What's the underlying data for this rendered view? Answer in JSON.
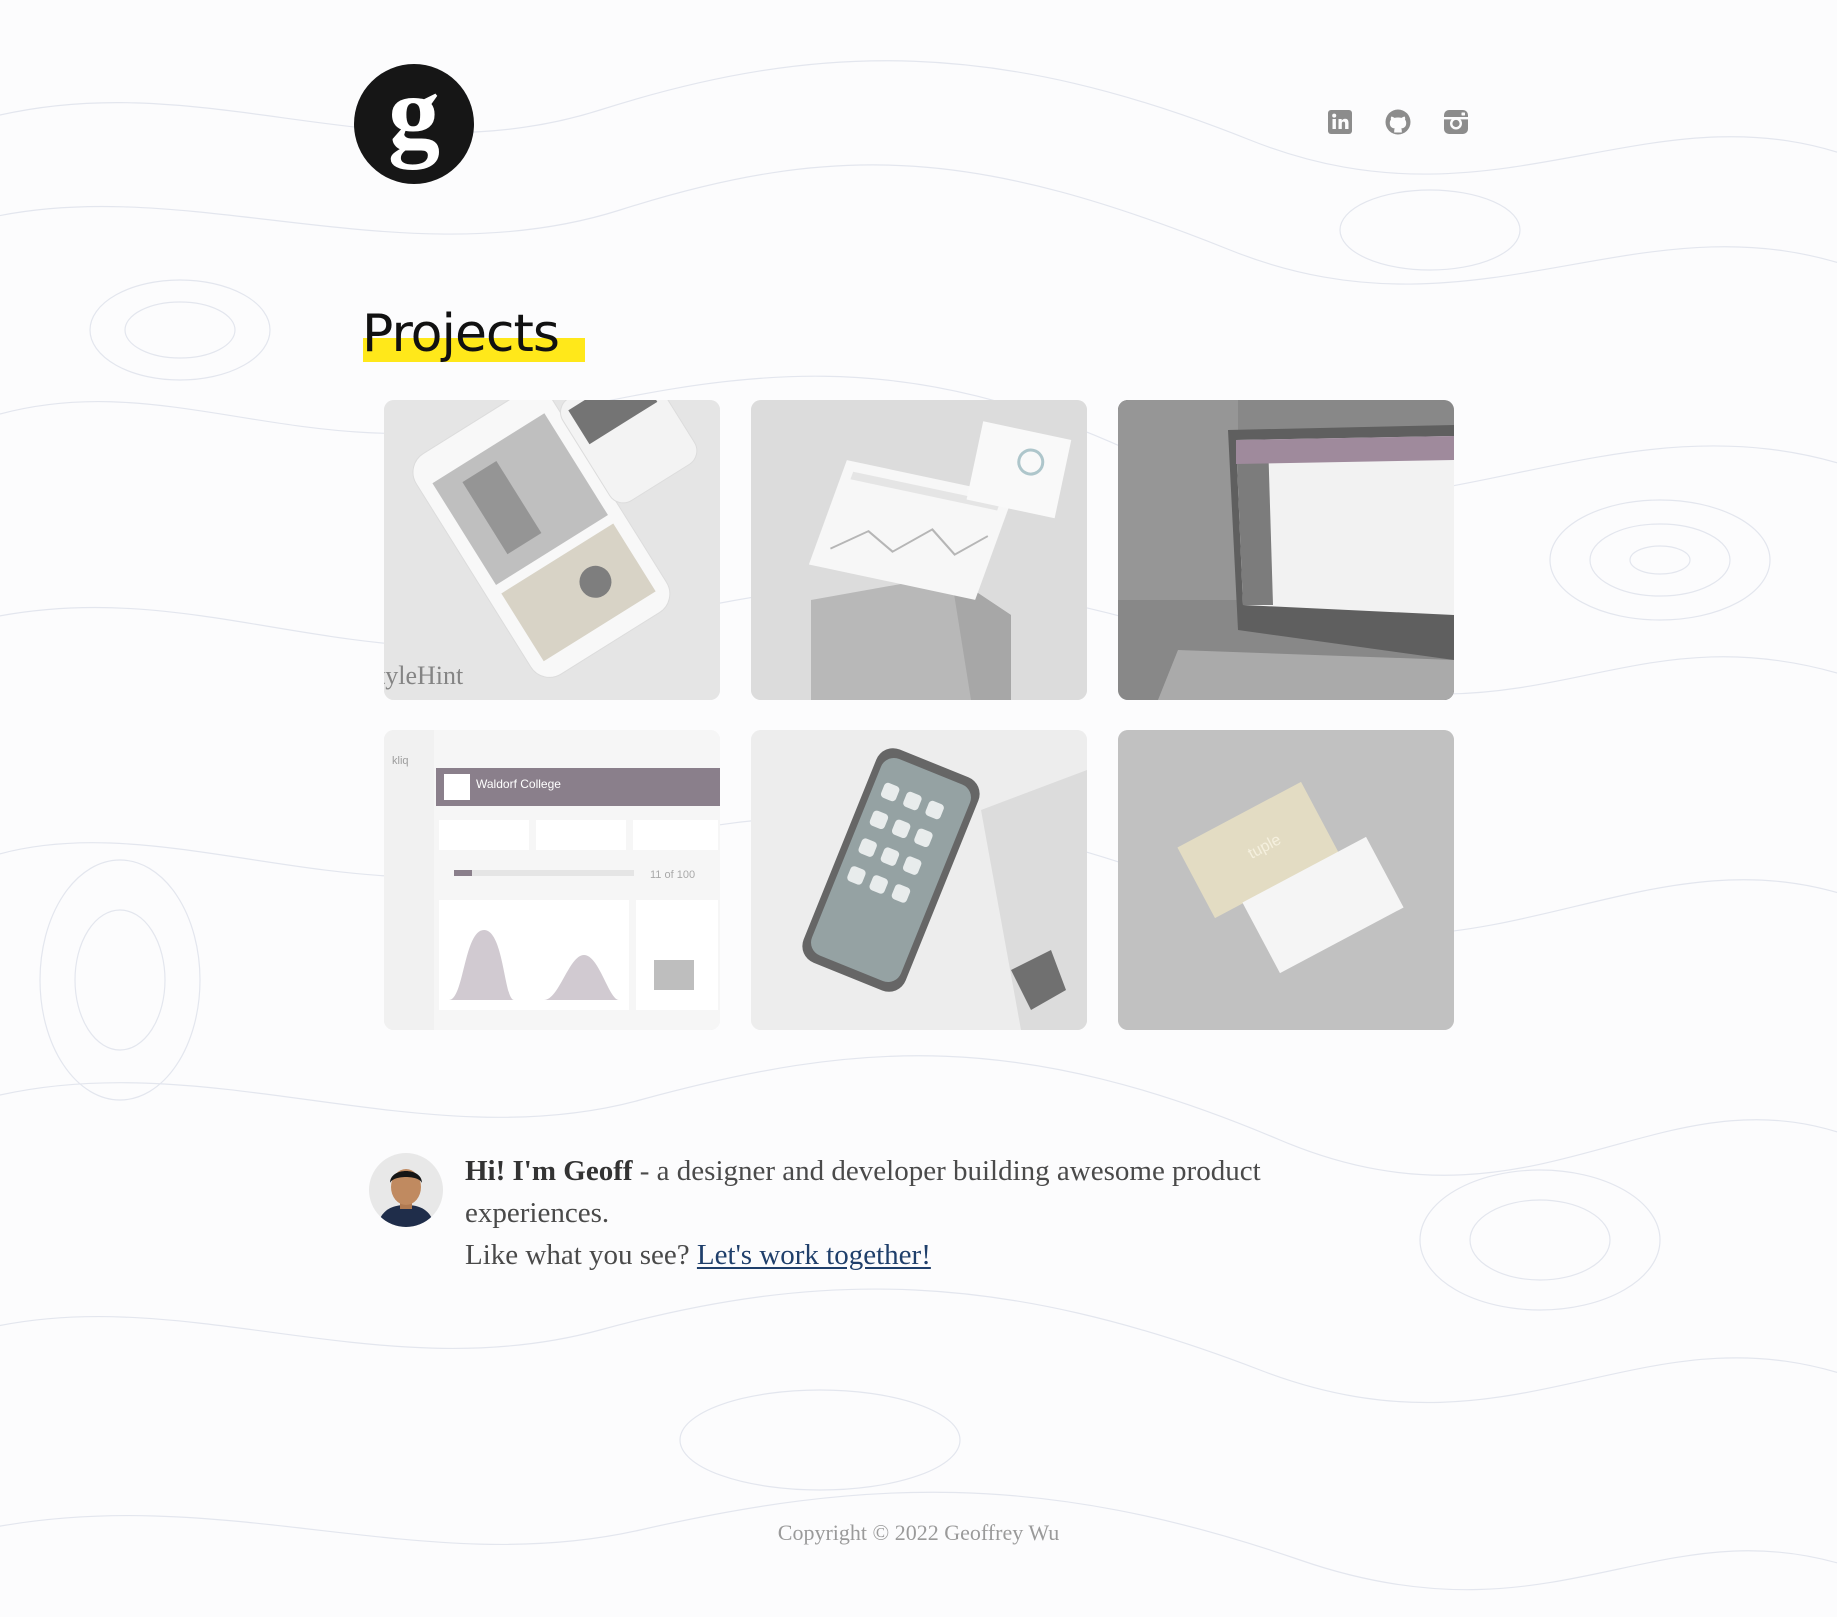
{
  "header": {
    "logo_letter": "g",
    "social_icons": [
      "linkedin-icon",
      "github-icon",
      "instagram-icon"
    ]
  },
  "projects": {
    "title": "Projects",
    "highlight_color": "#ffe81a",
    "cards": [
      {
        "name": "stylehint",
        "brand_text": "tyleHint"
      },
      {
        "name": "analytics-dashboard"
      },
      {
        "name": "laptop-portfolio-app"
      },
      {
        "name": "kliq-dashboard",
        "brand_text": "kliq",
        "header_text": "Waldorf College",
        "progress_text": "11 of 100"
      },
      {
        "name": "phone-icons"
      },
      {
        "name": "tuple-business-cards",
        "brand_text": "tuple"
      }
    ]
  },
  "bio": {
    "greeting": "Hi! I'm Geoff",
    "tagline": " - a designer and developer building awesome product experiences.",
    "cta_prefix": "Like what you see? ",
    "cta_link": "Let's work together!",
    "link_color": "#1f3f6b"
  },
  "footer": {
    "copyright": "Copyright © 2022 Geoffrey Wu"
  }
}
